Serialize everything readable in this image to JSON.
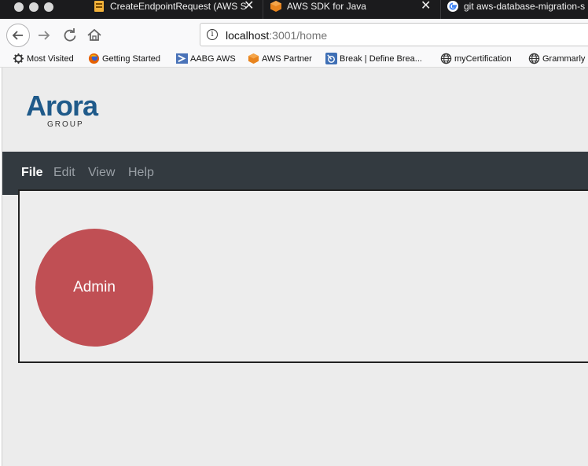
{
  "browser": {
    "tabs": [
      {
        "title": "CreateEndpointRequest (AWS S",
        "icon": "aws-doc-icon"
      },
      {
        "title": "AWS SDK for Java",
        "icon": "aws-cube-icon"
      },
      {
        "title": "git aws-database-migration-s",
        "icon": "google-icon"
      }
    ],
    "close_glyph": "✕",
    "url_host": "localhost",
    "url_rest": ":3001/home",
    "bookmarks": [
      {
        "label": "Most Visited",
        "icon": "gear-icon"
      },
      {
        "label": "Getting Started",
        "icon": "firefox-icon"
      },
      {
        "label": "AABG AWS",
        "icon": "aabg-icon"
      },
      {
        "label": "AWS Partner",
        "icon": "aws-cube-icon"
      },
      {
        "label": "Break | Define Brea...",
        "icon": "break-icon"
      },
      {
        "label": "myCertification",
        "icon": "globe-icon"
      },
      {
        "label": "Grammarly",
        "icon": "globe-icon"
      }
    ]
  },
  "app": {
    "logo_name": "Arora",
    "logo_sub": "GROUP",
    "menu": [
      "File",
      "Edit",
      "View",
      "Help"
    ],
    "active_menu": "File",
    "admin_label": "Admin",
    "colors": {
      "menubar": "#333a40",
      "admin_circle": "#c04f54",
      "logo": "#1f5a8a"
    }
  }
}
